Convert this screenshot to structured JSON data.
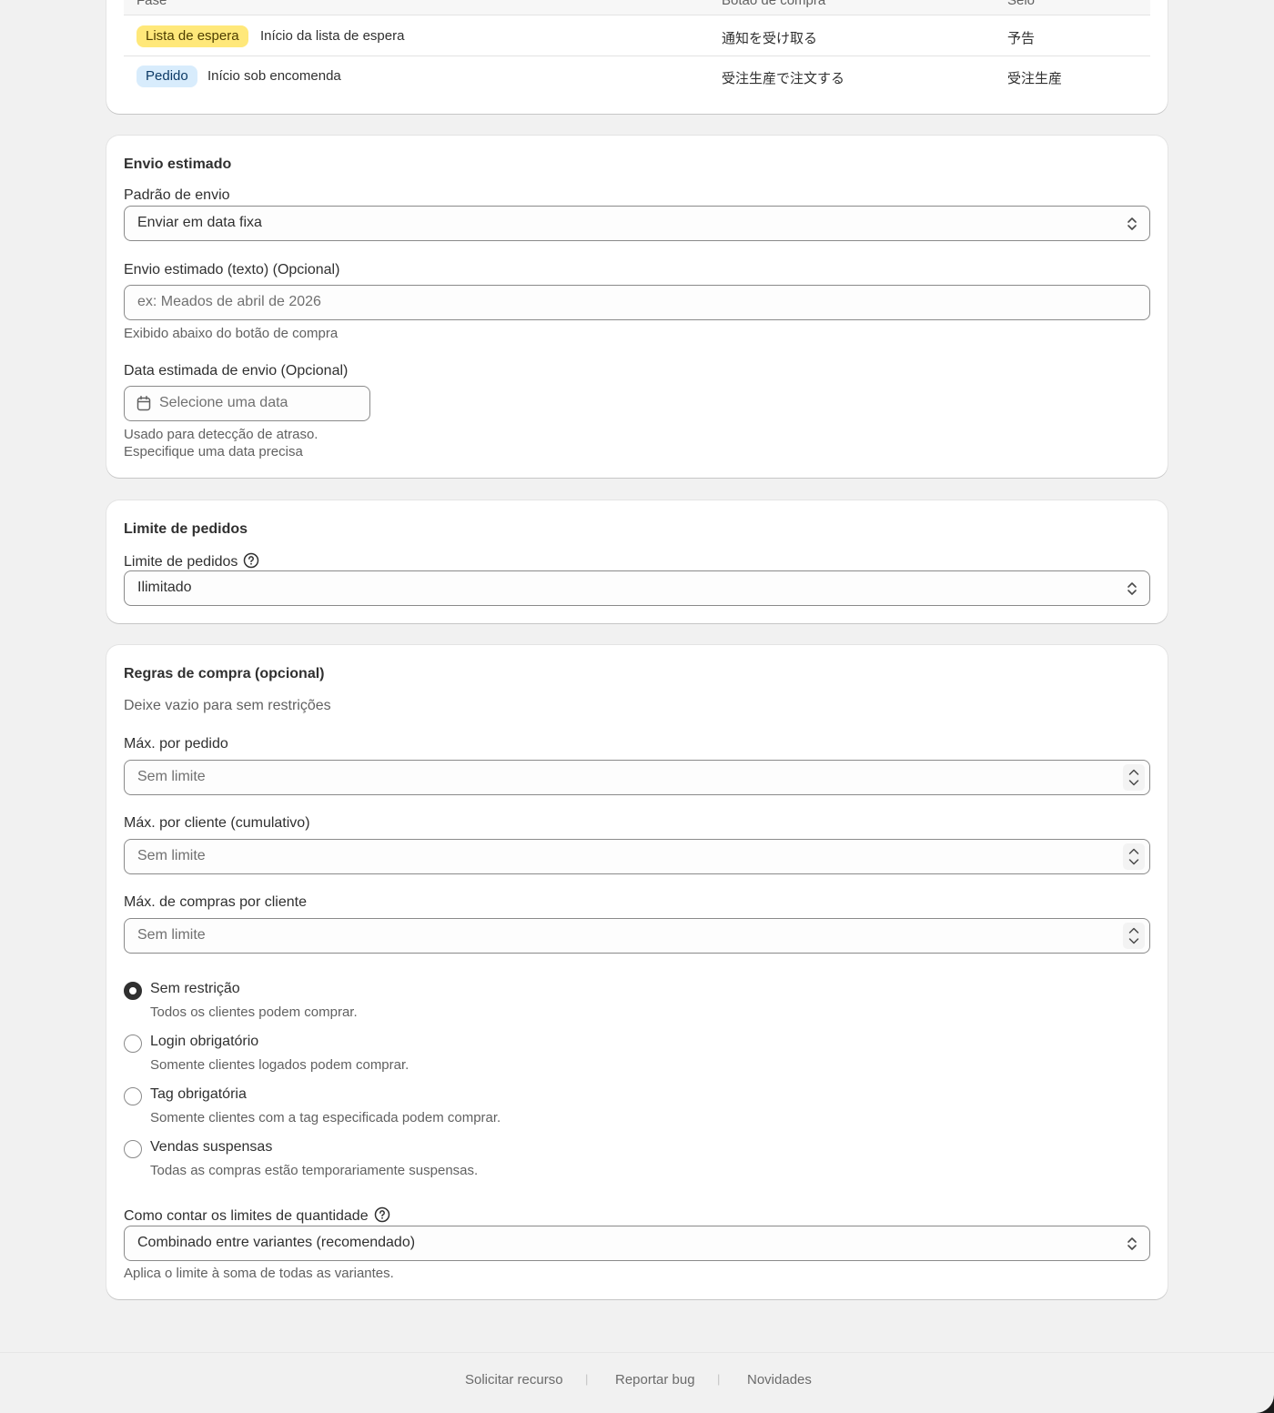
{
  "phases_table": {
    "headers": [
      "Fase",
      "Botão de compra",
      "Selo"
    ],
    "rows": [
      {
        "badge": "Lista de espera",
        "badge_color": "#ffe87a",
        "description": "Início da lista de espera",
        "button": "通知を受け取る",
        "seal": "予告"
      },
      {
        "badge": "Pedido",
        "badge_color": "#d8ecfc",
        "description": "Início sob encomenda",
        "button": "受注生産で注文する",
        "seal": "受注生産"
      }
    ]
  },
  "shipping": {
    "title": "Envio estimado",
    "pattern_label": "Padrão de envio",
    "pattern_value": "Enviar em data fixa",
    "text_label": "Envio estimado (texto) (Opcional)",
    "text_placeholder": "ex: Meados de abril de 2026",
    "text_help": "Exibido abaixo do botão de compra",
    "date_label": "Data estimada de envio (Opcional)",
    "date_placeholder": "Selecione uma data",
    "date_help_1": "Usado para detecção de atraso.",
    "date_help_2": "Especifique uma data precisa"
  },
  "order_limit": {
    "title": "Limite de pedidos",
    "label": "Limite de pedidos",
    "value": "Ilimitado"
  },
  "purchase_rules": {
    "title": "Regras de compra (opcional)",
    "subtitle": "Deixe vazio para sem restrições",
    "max_per_order_label": "Máx. por pedido",
    "max_per_order_placeholder": "Sem limite",
    "max_per_customer_label": "Máx. por cliente (cumulativo)",
    "max_per_customer_placeholder": "Sem limite",
    "max_purchases_label": "Máx. de compras por cliente",
    "max_purchases_placeholder": "Sem limite",
    "options": [
      {
        "label": "Sem restrição",
        "help": "Todos os clientes podem comprar.",
        "selected": true
      },
      {
        "label": "Login obrigatório",
        "help": "Somente clientes logados podem comprar.",
        "selected": false
      },
      {
        "label": "Tag obrigatória",
        "help": "Somente clientes com a tag especificada podem comprar.",
        "selected": false
      },
      {
        "label": "Vendas suspensas",
        "help": "Todas as compras estão temporariamente suspensas.",
        "selected": false
      }
    ],
    "count_label": "Como contar os limites de quantidade",
    "count_value": "Combinado entre variantes (recomendado)",
    "count_help": "Aplica o limite à soma de todas as variantes."
  },
  "footer": {
    "links": [
      "Solicitar recurso",
      "Reportar bug",
      "Novidades"
    ],
    "separator": "|"
  },
  "icons": {
    "select": "chevron-up-down-icon",
    "calendar": "calendar-icon",
    "help": "question-circle-icon",
    "stepper": "stepper-arrows-icon"
  }
}
